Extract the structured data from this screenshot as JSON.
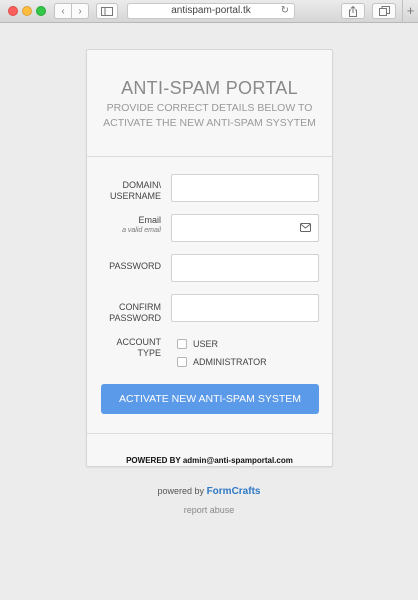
{
  "browser": {
    "url": "antispam-portal.tk",
    "back_glyph": "‹",
    "forward_glyph": "›",
    "reload_glyph": "↻",
    "newtab_glyph": "+"
  },
  "form": {
    "title": "ANTI-SPAM PORTAL",
    "subtitle": "PROVIDE CORRECT DETAILS BELOW TO ACTIVATE THE NEW ANTI-SPAM SYSYTEM",
    "domain_label": "DOMAIN\\ USERNAME",
    "email_label": "Email",
    "email_hint": "a valid email",
    "password_label": "PASSWORD",
    "confirm_label": "CONFIRM PASSWORD",
    "account_type_label": "ACCOUNT TYPE",
    "option_user": "USER",
    "option_admin": "ADMINISTRATOR",
    "submit_label": "ACTIVATE NEW ANTI-SPAM SYSTEM",
    "powered_by": "POWERED BY  admin@anti-spamportal.com"
  },
  "footer": {
    "powered_prefix": "powered by",
    "powered_brand": "FormCrafts",
    "report": "report abuse"
  },
  "colors": {
    "button": "#5b9ae9",
    "brand_link": "#2f78c4"
  },
  "icons": {
    "email_field": "mail-icon"
  }
}
